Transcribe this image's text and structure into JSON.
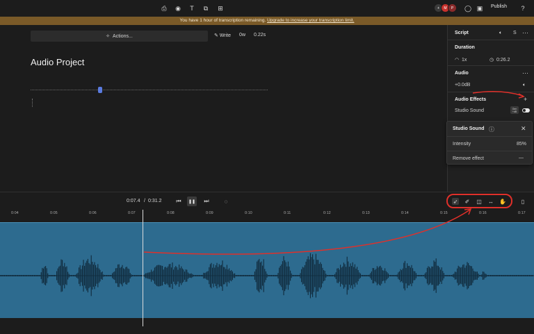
{
  "toolbar": {
    "icons": [
      "export-icon",
      "record-icon",
      "text-icon",
      "shapes-icon",
      "grid-icon"
    ],
    "avatars": [
      {
        "initials": "+",
        "color": "#3a3a3a"
      },
      {
        "initials": "M",
        "color": "#c8312c"
      },
      {
        "initials": "P",
        "color": "#8a2a2a"
      }
    ],
    "publish_label": "Publish"
  },
  "banner": {
    "text": "You have 1 hour of transcription remaining. ",
    "link": "Upgrade to increase your transcription limit."
  },
  "editor": {
    "actions_label": "Actions...",
    "write_label": "Write",
    "word_count": "0w",
    "duration": "0.22s",
    "title": "Audio Project"
  },
  "panel": {
    "script_label": "Script",
    "script_letter": "S",
    "duration_label": "Duration",
    "speed": "1x",
    "length": "0:26.2",
    "audio_label": "Audio",
    "gain": "+0.0dB",
    "effects_label": "Audio Effects",
    "studio_sound_label": "Studio Sound",
    "mini_button": "Gen\n+dB"
  },
  "popup": {
    "title": "Studio Sound",
    "intensity_label": "Intensity",
    "intensity_value": "85%",
    "intensity_level": 0.85,
    "remove_label": "Remove effect"
  },
  "transport": {
    "current": "0:07.4",
    "total": "0:31.2",
    "separator": "/"
  },
  "ruler": {
    "ticks": [
      "0:04",
      "0:05",
      "0:06",
      "0:07",
      "0:08",
      "0:09",
      "0:10",
      "0:11",
      "0:12",
      "0:13",
      "0:14",
      "0:15",
      "0:16",
      "0:17"
    ]
  },
  "colors": {
    "waveform_bg": "#2d6b8f",
    "annotation_red": "#e0302a",
    "banner": "#7a5a28"
  }
}
